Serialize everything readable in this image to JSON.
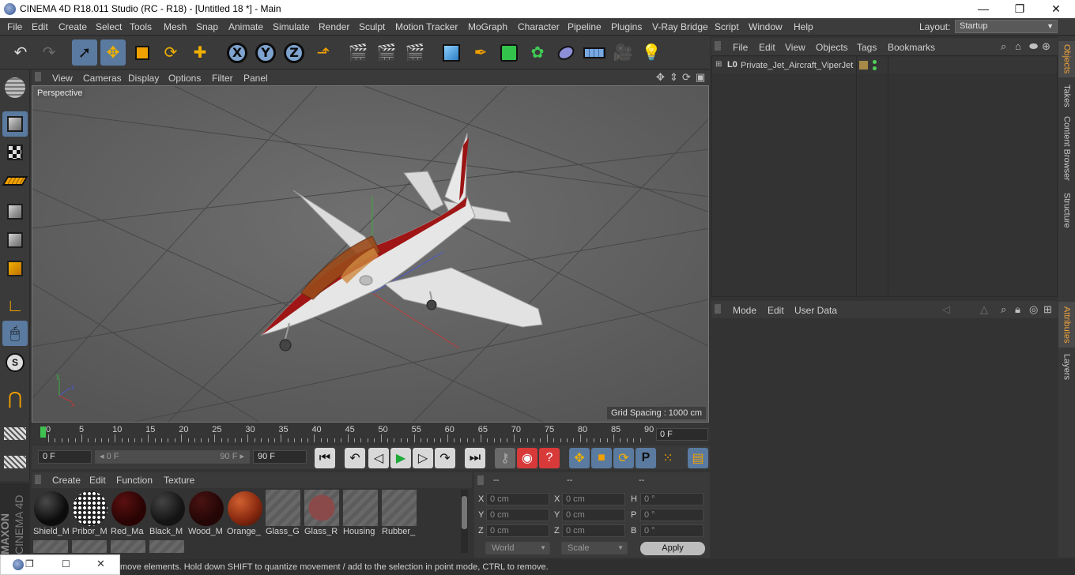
{
  "window": {
    "title": "CINEMA 4D R18.011 Studio (RC - R18) - [Untitled 18 *] - Main",
    "minimize": "—",
    "maximize": "❐",
    "close": "✕"
  },
  "menu": [
    "File",
    "Edit",
    "Create",
    "Select",
    "Tools",
    "Mesh",
    "Snap",
    "Animate",
    "Simulate",
    "Render",
    "Sculpt",
    "Motion Tracker",
    "MoGraph",
    "Character",
    "Pipeline",
    "Plugins",
    "V-Ray Bridge",
    "Script",
    "Window",
    "Help"
  ],
  "layout": {
    "label": "Layout:",
    "value": "Startup"
  },
  "viewport": {
    "menu": [
      "View",
      "Cameras",
      "Display",
      "Options",
      "Filter",
      "Panel"
    ],
    "label": "Perspective",
    "grid_spacing": "Grid Spacing : 1000 cm"
  },
  "timeline": {
    "ticks": [
      "0",
      "5",
      "10",
      "15",
      "20",
      "25",
      "30",
      "35",
      "40",
      "45",
      "50",
      "55",
      "60",
      "65",
      "70",
      "75",
      "80",
      "85",
      "90"
    ],
    "end_frame": "0 F"
  },
  "transport": {
    "start": "0 F",
    "range_start": "◂ 0 F",
    "range_end": "90 F ▸",
    "end": "90 F"
  },
  "materials": {
    "menu": [
      "Create",
      "Edit",
      "Function",
      "Texture"
    ],
    "items": [
      {
        "name": "Shield_M",
        "color": "#0c0c0c"
      },
      {
        "name": "Pribor_M",
        "color": "pattern"
      },
      {
        "name": "Red_Ma",
        "color": "#2a0404"
      },
      {
        "name": "Black_M",
        "color": "#141414"
      },
      {
        "name": "Wood_M",
        "color": "#240606"
      },
      {
        "name": "Orange_",
        "color": "#8a2a10"
      },
      {
        "name": "Glass_G",
        "color": "hatch"
      },
      {
        "name": "Glass_R",
        "color": "hatch-red"
      },
      {
        "name": "Housing",
        "color": "hatch"
      },
      {
        "name": "Rubber_",
        "color": "hatch"
      }
    ]
  },
  "coords": {
    "headers": [
      "--",
      "--",
      "--"
    ],
    "rows": [
      [
        {
          "label": "X",
          "value": "0 cm"
        },
        {
          "label": "X",
          "value": "0 cm"
        },
        {
          "label": "H",
          "value": "0 °"
        }
      ],
      [
        {
          "label": "Y",
          "value": "0 cm"
        },
        {
          "label": "Y",
          "value": "0 cm"
        },
        {
          "label": "P",
          "value": "0 °"
        }
      ],
      [
        {
          "label": "Z",
          "value": "0 cm"
        },
        {
          "label": "Z",
          "value": "0 cm"
        },
        {
          "label": "B",
          "value": "0 °"
        }
      ]
    ],
    "mode1": "World",
    "mode2": "Scale",
    "apply": "Apply"
  },
  "objects": {
    "menu": [
      "File",
      "Edit",
      "View",
      "Objects",
      "Tags",
      "Bookmarks"
    ],
    "items": [
      {
        "name": "Private_Jet_Aircraft_ViperJet"
      }
    ]
  },
  "attributes": {
    "menu": [
      "Mode",
      "Edit",
      "User Data"
    ]
  },
  "right_tabs": [
    "Objects",
    "Takes",
    "Content Browser",
    "Structure",
    "Attributes",
    "Layers"
  ],
  "status": "move elements. Hold down SHIFT to quantize movement / add to the selection in point mode, CTRL to remove.",
  "brand": {
    "line1": "MAXON",
    "line2": "CINEMA 4D"
  }
}
